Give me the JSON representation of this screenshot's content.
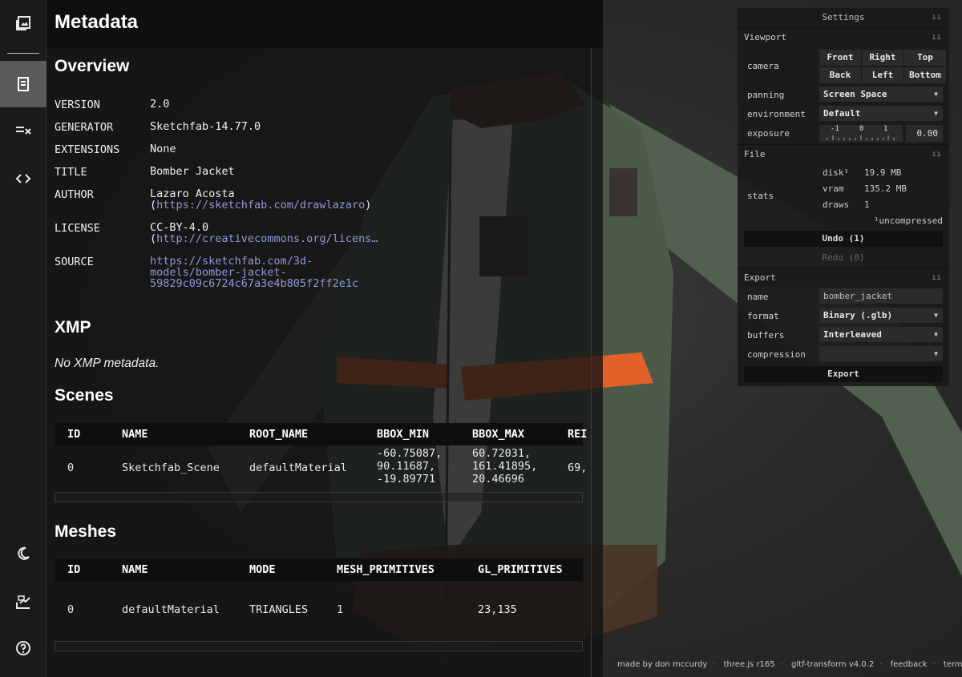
{
  "rail": {
    "items": [
      {
        "name": "gallery-icon",
        "glyph": "▣"
      },
      {
        "name": "metadata-icon",
        "glyph": "▤"
      },
      {
        "name": "validation-icon",
        "glyph": "≡✕"
      },
      {
        "name": "code-icon",
        "glyph": "<>"
      },
      {
        "name": "theme-moon-icon",
        "glyph": "☾"
      },
      {
        "name": "share-icon",
        "glyph": "⤴"
      },
      {
        "name": "help-icon",
        "glyph": "?"
      }
    ]
  },
  "panel": {
    "title": "Metadata",
    "overview": {
      "heading": "Overview",
      "rows": [
        {
          "key": "VERSION",
          "value": "2.0"
        },
        {
          "key": "GENERATOR",
          "value": "Sketchfab-14.77.0"
        },
        {
          "key": "EXTENSIONS",
          "value": "None"
        },
        {
          "key": "TITLE",
          "value": "Bomber Jacket"
        },
        {
          "key": "AUTHOR",
          "value": "Lazaro Acosta",
          "link_prefix": "(",
          "link": "https://sketchfab.com/drawlazaro",
          "link_suffix": ")"
        },
        {
          "key": "LICENSE",
          "value": "CC-BY-4.0",
          "link_prefix": "(",
          "link": "http://creativecommons.org/licens…"
        },
        {
          "key": "SOURCE",
          "link_lines": [
            "https://sketchfab.com/3d-",
            "models/bomber-jacket-",
            "59829c09c6724c67a3e4b805f2ff2e1c"
          ]
        }
      ]
    },
    "xmp": {
      "heading": "XMP",
      "empty_text": "No XMP metadata."
    },
    "scenes": {
      "heading": "Scenes",
      "columns": [
        "ID",
        "NAME",
        "ROOT_NAME",
        "BBOX_MIN",
        "BBOX_MAX",
        "REI"
      ],
      "rows": [
        {
          "id": "0",
          "name": "Sketchfab_Scene",
          "root_name": "defaultMaterial",
          "bbox_min": [
            "-60.75087,",
            "90.11687,",
            "-19.89771"
          ],
          "bbox_max": [
            "60.72031,",
            "161.41895,",
            "20.46696"
          ],
          "rei": "69,"
        }
      ]
    },
    "meshes": {
      "heading": "Meshes",
      "columns": [
        "ID",
        "NAME",
        "MODE",
        "MESH_PRIMITIVES",
        "GL_PRIMITIVES"
      ],
      "rows": [
        {
          "id": "0",
          "name": "defaultMaterial",
          "mode": "TRIANGLES",
          "mesh_primitives": "1",
          "gl_primitives": "23,135"
        }
      ]
    }
  },
  "settings": {
    "title": "Settings",
    "viewport": {
      "folder": "Viewport",
      "camera_label": "camera",
      "camera_buttons": [
        "Front",
        "Right",
        "Top",
        "Back",
        "Left",
        "Bottom"
      ],
      "panning_label": "panning",
      "panning_value": "Screen Space",
      "environment_label": "environment",
      "environment_value": "Default",
      "exposure_label": "exposure",
      "exposure_ticks": [
        "-1",
        "0",
        "1"
      ],
      "exposure_value": "0.00"
    },
    "file": {
      "folder": "File",
      "stats_label": "stats",
      "stats": [
        {
          "k": "disk¹",
          "v": "19.9 MB"
        },
        {
          "k": "vram",
          "v": "135.2 MB"
        },
        {
          "k": "draws",
          "v": "1"
        }
      ],
      "footnote": "¹uncompressed",
      "undo": "Undo (1)",
      "redo": "Redo (0)"
    },
    "export": {
      "folder": "Export",
      "name_label": "name",
      "name_value": "bomber_jacket",
      "format_label": "format",
      "format_value": "Binary (.glb)",
      "buffers_label": "buffers",
      "buffers_value": "Interleaved",
      "compression_label": "compression",
      "compression_value": "",
      "export_button": "Export"
    }
  },
  "footer": [
    "made by don mccurdy",
    "three.js r165",
    "gltf-transform v4.0.2",
    "feedback",
    "terms"
  ],
  "colors": {
    "jacket": "#4a5a4b",
    "stripe": "#e2612a",
    "collar": "#4a2f24",
    "link": "#8e9ad8"
  }
}
